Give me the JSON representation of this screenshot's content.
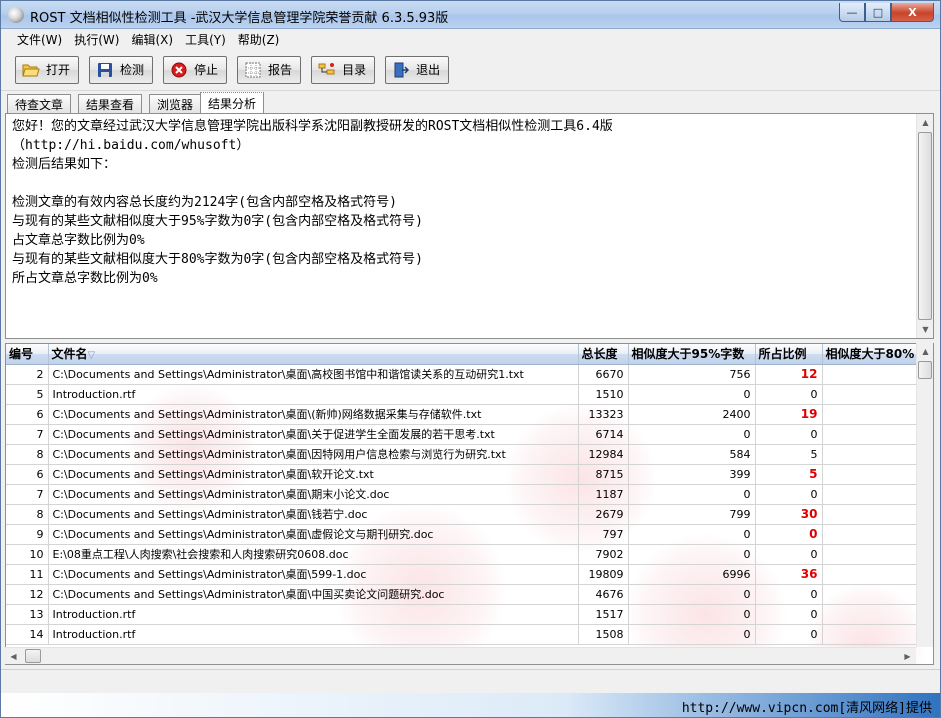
{
  "window": {
    "title": "ROST 文档相似性检测工具 -武汉大学信息管理学院荣誉贡献 6.3.5.93版",
    "controls": {
      "minimize": "—",
      "maximize": "□",
      "close": "X"
    }
  },
  "menu": [
    "文件(W)",
    "执行(W)",
    "编辑(X)",
    "工具(Y)",
    "帮助(Z)"
  ],
  "toolbar": [
    {
      "label": "打开",
      "icon": "open-folder-icon"
    },
    {
      "label": "检测",
      "icon": "floppy-disk-icon"
    },
    {
      "label": "停止",
      "icon": "stop-icon"
    },
    {
      "label": "报告",
      "icon": "report-grid-icon"
    },
    {
      "label": "目录",
      "icon": "directory-tree-icon"
    },
    {
      "label": "退出",
      "icon": "exit-door-icon"
    }
  ],
  "tabs": [
    {
      "label": "待查文章",
      "active": false
    },
    {
      "label": "结果查看",
      "active": false
    },
    {
      "label": "浏览器",
      "active": false
    },
    {
      "label": "结果分析",
      "active": true
    }
  ],
  "result_text": "您好！您的文章经过武汉大学信息管理学院出版科学系沈阳副教授研发的ROST文档相似性检测工具6.4版\n（http://hi.baidu.com/whusoft）\n检测后结果如下：\n\n检测文章的有效内容总长度约为2124字(包含内部空格及格式符号)\n与现有的某些文献相似度大于95%字数为0字(包含内部空格及格式符号)\n占文章总字数比例为0%\n与现有的某些文献相似度大于80%字数为0字(包含内部空格及格式符号)\n所占文章总字数比例为0%",
  "table": {
    "columns": [
      "编号",
      "文件名",
      "总长度",
      "相似度大于95%字数",
      "所占比例",
      "相似度大于80%"
    ],
    "sort_indicator": "▽",
    "rows": [
      {
        "id": "2",
        "file": "C:\\Documents and Settings\\Administrator\\桌面\\高校图书馆中和谐馆读关系的互动研究1.txt",
        "length": "6670",
        "count95": "756",
        "ratio": "12",
        "highlight": true
      },
      {
        "id": "5",
        "file": "Introduction.rtf",
        "length": "1510",
        "count95": "0",
        "ratio": "0",
        "highlight": false
      },
      {
        "id": "6",
        "file": "C:\\Documents and Settings\\Administrator\\桌面\\(新帅)网络数据采集与存储软件.txt",
        "length": "13323",
        "count95": "2400",
        "ratio": "19",
        "highlight": true
      },
      {
        "id": "7",
        "file": "C:\\Documents and Settings\\Administrator\\桌面\\关于促进学生全面发展的若干思考.txt",
        "length": "6714",
        "count95": "0",
        "ratio": "0",
        "highlight": false
      },
      {
        "id": "8",
        "file": "C:\\Documents and Settings\\Administrator\\桌面\\因特网用户信息检索与浏览行为研究.txt",
        "length": "12984",
        "count95": "584",
        "ratio": "5",
        "highlight": false
      },
      {
        "id": "6",
        "file": "C:\\Documents and Settings\\Administrator\\桌面\\软开论文.txt",
        "length": "8715",
        "count95": "399",
        "ratio": "5",
        "highlight": true
      },
      {
        "id": "7",
        "file": "C:\\Documents and Settings\\Administrator\\桌面\\期末小论文.doc",
        "length": "1187",
        "count95": "0",
        "ratio": "0",
        "highlight": false
      },
      {
        "id": "8",
        "file": "C:\\Documents and Settings\\Administrator\\桌面\\钱若宁.doc",
        "length": "2679",
        "count95": "799",
        "ratio": "30",
        "highlight": true
      },
      {
        "id": "9",
        "file": "C:\\Documents and Settings\\Administrator\\桌面\\虚假论文与期刊研究.doc",
        "length": "797",
        "count95": "0",
        "ratio": "0",
        "highlight": true
      },
      {
        "id": "10",
        "file": "E:\\08重点工程\\人肉搜索\\社会搜索和人肉搜索研究0608.doc",
        "length": "7902",
        "count95": "0",
        "ratio": "0",
        "highlight": false
      },
      {
        "id": "11",
        "file": "C:\\Documents and Settings\\Administrator\\桌面\\599-1.doc",
        "length": "19809",
        "count95": "6996",
        "ratio": "36",
        "highlight": true
      },
      {
        "id": "12",
        "file": "C:\\Documents and Settings\\Administrator\\桌面\\中国买卖论文问题研究.doc",
        "length": "4676",
        "count95": "0",
        "ratio": "0",
        "highlight": false
      },
      {
        "id": "13",
        "file": "Introduction.rtf",
        "length": "1517",
        "count95": "0",
        "ratio": "0",
        "highlight": false
      },
      {
        "id": "14",
        "file": "Introduction.rtf",
        "length": "1508",
        "count95": "0",
        "ratio": "0",
        "highlight": false
      }
    ]
  },
  "watermark": "http://www.vipcn.com[清风网络]提供",
  "colors": {
    "highlight": "#e00000",
    "title_bar": "#b7cfee",
    "header": "#c0d2ec"
  }
}
